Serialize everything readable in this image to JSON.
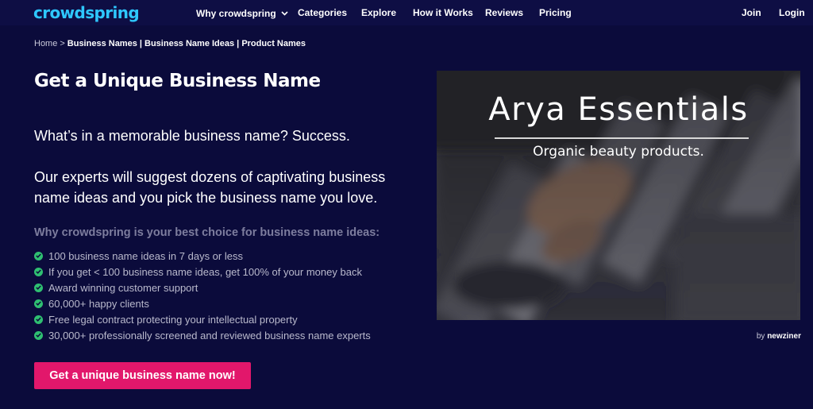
{
  "brand": {
    "logo_text": "crowdspring",
    "logo_color": "#2ec7ff"
  },
  "nav": {
    "why": "Why crowdspring",
    "categories": "Categories",
    "explore": "Explore",
    "how": "How it Works",
    "reviews": "Reviews",
    "pricing": "Pricing",
    "join": "Join",
    "login": "Login"
  },
  "breadcrumb": {
    "home": "Home",
    "sep": ">",
    "path": "Business Names | Business Name Ideas | Product Names"
  },
  "hero": {
    "title": "Get a Unique Business Name",
    "lead1": "What’s in a memorable business name? Success.",
    "lead2": "Our experts will suggest dozens of captivating business name ideas and you pick the business name you love.",
    "why_heading": "Why crowdspring is your best choice for business name ideas:",
    "features": [
      "100 business name ideas in 7 days or less",
      "If you get < 100 business name ideas, get 100% of your money back",
      "Award winning customer support",
      "60,000+ happy clients",
      "Free legal contract protecting your intellectual property",
      "30,000+ professionally screened and reviewed business name experts"
    ],
    "cta": "Get a unique business name now!"
  },
  "showcase": {
    "name": "Arya Essentials",
    "tagline": "Organic beauty products.",
    "credit_by": "by",
    "credit_author": "newziner"
  },
  "colors": {
    "background": "#0b0b3b",
    "cta": "#e2176b",
    "check": "#2fbf71",
    "muted_heading": "#7d7d9e"
  }
}
